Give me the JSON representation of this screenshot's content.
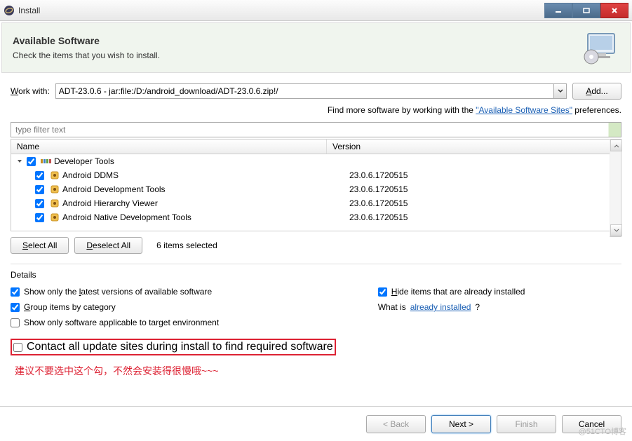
{
  "titlebar": {
    "title": "Install"
  },
  "header": {
    "title": "Available Software",
    "subtitle": "Check the items that you wish to install."
  },
  "workwith": {
    "label_pre": "W",
    "label_post": "ork with:",
    "value": "ADT-23.0.6 - jar:file:/D:/android_download/ADT-23.0.6.zip!/",
    "add_label": "Add..."
  },
  "find_more": {
    "pre": "Find more software by working with the ",
    "link": "\"Available Software Sites\"",
    "post": " preferences."
  },
  "filter_placeholder": "type filter text",
  "tree": {
    "header_name": "Name",
    "header_version": "Version",
    "category": "Developer Tools",
    "items": [
      {
        "name": "Android DDMS",
        "version": "23.0.6.1720515"
      },
      {
        "name": "Android Development Tools",
        "version": "23.0.6.1720515"
      },
      {
        "name": "Android Hierarchy Viewer",
        "version": "23.0.6.1720515"
      },
      {
        "name": "Android Native Development Tools",
        "version": "23.0.6.1720515"
      }
    ]
  },
  "buttons": {
    "select_all": "Select All",
    "deselect_all": "Deselect All",
    "selected_count": "6 items selected"
  },
  "details_label": "Details",
  "options": {
    "show_latest": "Show only the latest versions of available software",
    "group_category": "Group items by category",
    "show_applicable": "Show only software applicable to target environment",
    "contact_sites": "Contact all update sites during install to find required software",
    "hide_installed": "Hide items that are already installed",
    "whatis_pre": "What is ",
    "whatis_link": "already installed",
    "whatis_post": "?"
  },
  "annotation": "建议不要选中这个勾，不然会安装得很慢哦~~~",
  "footer": {
    "back": "< Back",
    "next": "Next >",
    "finish": "Finish",
    "cancel": "Cancel"
  },
  "watermark": "@51CTO博客"
}
